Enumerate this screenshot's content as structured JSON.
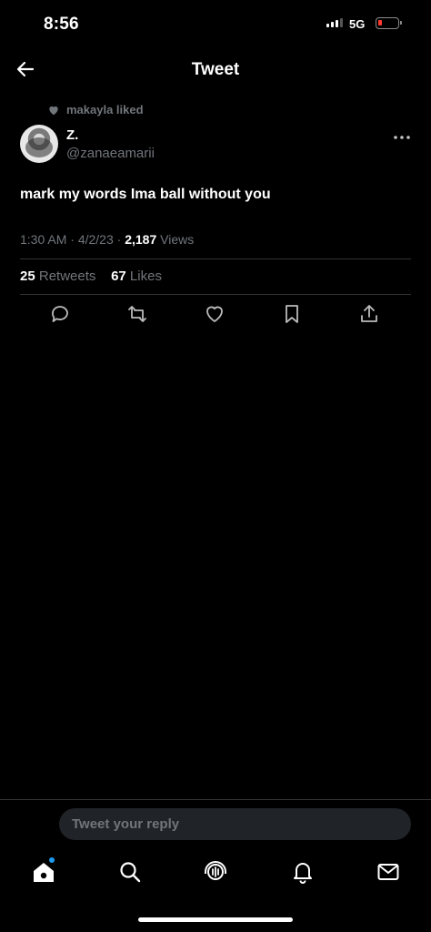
{
  "status_bar": {
    "time": "8:56",
    "network": "5G",
    "battery_color": "#ff3b30"
  },
  "header": {
    "title": "Tweet",
    "back_icon": "arrow-left-icon"
  },
  "social_context": {
    "icon": "heart-icon",
    "text": "makayla liked"
  },
  "tweet": {
    "author_name": "Z.",
    "author_handle": "@zanaeamarii",
    "text": "mark my words Ima ball without you",
    "time": "1:30 AM",
    "date": "4/2/23",
    "views_count": "2,187",
    "views_label": "Views",
    "retweets_count": "25",
    "retweets_label": "Retweets",
    "likes_count": "67",
    "likes_label": "Likes"
  },
  "actions": [
    "reply-icon",
    "retweet-icon",
    "like-icon",
    "bookmark-icon",
    "share-icon"
  ],
  "reply_box": {
    "placeholder": "Tweet your reply"
  },
  "bottom_nav": [
    "home-icon",
    "search-icon",
    "spaces-icon",
    "notifications-icon",
    "messages-icon"
  ],
  "colors": {
    "background": "#000000",
    "secondary_text": "#71767b",
    "divider": "#2f3336",
    "accent": "#1d9bf0"
  }
}
